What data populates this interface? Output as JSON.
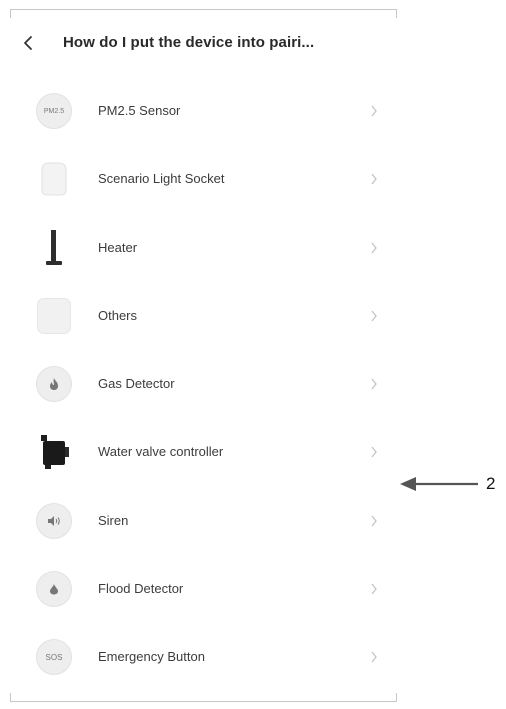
{
  "header": {
    "title": "How do I put the device into pairi..."
  },
  "devices": [
    {
      "label": "PM2.5 Sensor",
      "icon": "pm25-sensor-icon",
      "badge": "PM2.5"
    },
    {
      "label": "Scenario Light Socket",
      "icon": "light-socket-icon"
    },
    {
      "label": "Heater",
      "icon": "heater-icon"
    },
    {
      "label": "Others",
      "icon": "others-icon"
    },
    {
      "label": "Gas Detector",
      "icon": "flame-icon"
    },
    {
      "label": "Water valve controller",
      "icon": "water-valve-icon"
    },
    {
      "label": "Siren",
      "icon": "speaker-icon"
    },
    {
      "label": "Flood Detector",
      "icon": "water-drop-icon"
    },
    {
      "label": "Emergency Button",
      "icon": "sos-icon",
      "badge": "SOS"
    }
  ],
  "callout": {
    "number": "2"
  },
  "colors": {
    "text": "#3c3c3c",
    "chevron": "#c4c4c4",
    "icon_bg": "#eeeeee"
  }
}
